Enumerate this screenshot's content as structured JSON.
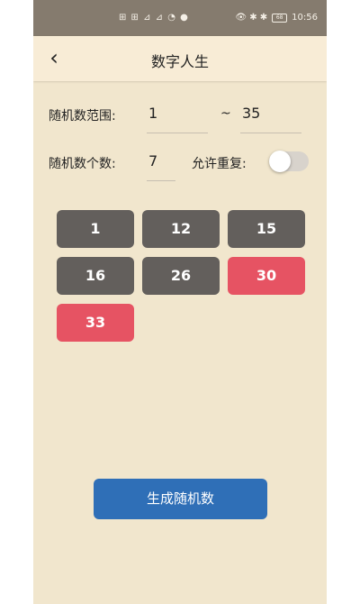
{
  "status_bar": {
    "left_icons": "⊞ ⊞ ⊿ ⊿ ◔ ●",
    "right_icons": "👁 ✱ ✱",
    "battery": "68",
    "time": "10:56"
  },
  "header": {
    "title": "数字人生"
  },
  "range": {
    "label": "随机数范围:",
    "min": "1",
    "separator": "~",
    "max": "35"
  },
  "count": {
    "label": "随机数个数:",
    "value": "7"
  },
  "repeat": {
    "label": "允许重复:",
    "enabled": false
  },
  "numbers": [
    {
      "value": "1",
      "color": "#635f5c"
    },
    {
      "value": "12",
      "color": "#635f5c"
    },
    {
      "value": "15",
      "color": "#635f5c"
    },
    {
      "value": "16",
      "color": "#635f5c"
    },
    {
      "value": "26",
      "color": "#635f5c"
    },
    {
      "value": "30",
      "color": "#e65363"
    },
    {
      "value": "33",
      "color": "#e65363"
    }
  ],
  "actions": {
    "generate_label": "生成随机数"
  },
  "colors": {
    "background": "#f1e6cd",
    "appbar": "#f8ecd6",
    "chip_default": "#635f5c",
    "chip_highlight": "#e65363",
    "primary_button": "#2f6fb7"
  }
}
